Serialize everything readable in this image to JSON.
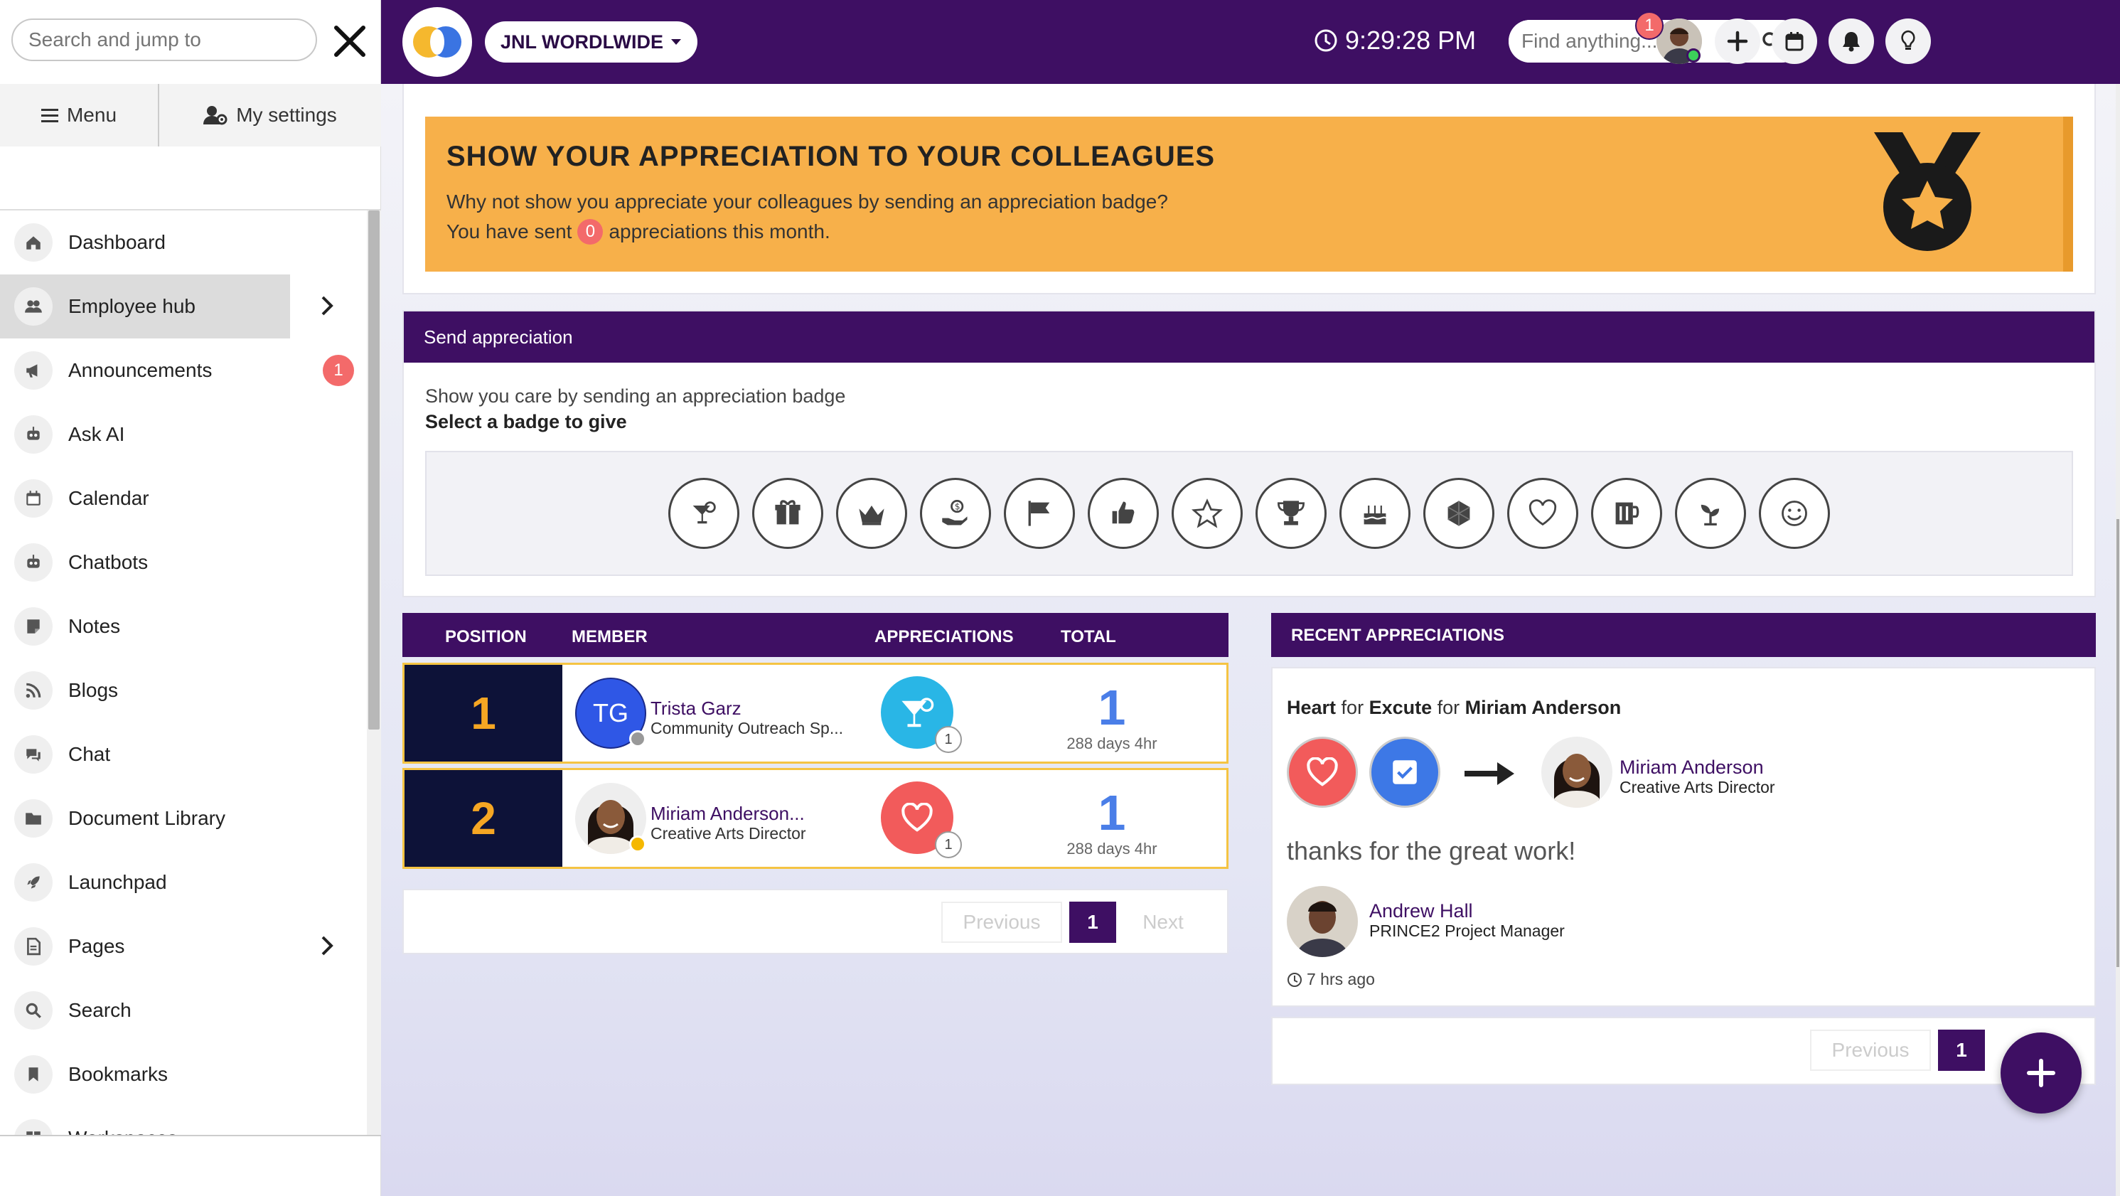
{
  "sidebar": {
    "search_placeholder": "Search and jump to",
    "tabs": {
      "menu": "Menu",
      "settings": "My settings"
    },
    "items": [
      {
        "label": "Dashboard",
        "icon": "home-icon"
      },
      {
        "label": "Employee hub",
        "icon": "users-icon",
        "active": true,
        "has_submenu": true
      },
      {
        "label": "Announcements",
        "icon": "megaphone-icon",
        "badge": "1"
      },
      {
        "label": "Ask AI",
        "icon": "robot-icon"
      },
      {
        "label": "Calendar",
        "icon": "calendar-icon"
      },
      {
        "label": "Chatbots",
        "icon": "robot-icon"
      },
      {
        "label": "Notes",
        "icon": "note-icon"
      },
      {
        "label": "Blogs",
        "icon": "rss-icon"
      },
      {
        "label": "Chat",
        "icon": "chat-icon"
      },
      {
        "label": "Document Library",
        "icon": "folder-icon"
      },
      {
        "label": "Launchpad",
        "icon": "rocket-icon"
      },
      {
        "label": "Pages",
        "icon": "page-icon",
        "has_submenu": true
      },
      {
        "label": "Search",
        "icon": "search-icon"
      },
      {
        "label": "Bookmarks",
        "icon": "bookmark-icon"
      },
      {
        "label": "Workspaces",
        "icon": "workspace-icon"
      }
    ]
  },
  "topbar": {
    "org_name": "JNL WORDLWIDE",
    "time": "9:29:28 PM",
    "find_placeholder": "Find anything...",
    "notification_count": "1"
  },
  "banner": {
    "title": "SHOW YOUR APPRECIATION TO YOUR COLLEAGUES",
    "line1": "Why not show you appreciate your colleagues by sending an appreciation badge?",
    "line2_prefix": "You have sent",
    "sent_count": "0",
    "line2_suffix": "appreciations this month."
  },
  "send": {
    "header": "Send appreciation",
    "subtitle": "Show you care by sending an appreciation badge",
    "select_label": "Select a badge to give",
    "badges": [
      "cocktail-icon",
      "gift-icon",
      "crown-icon",
      "hand-coin-icon",
      "flag-icon",
      "thumbs-up-icon",
      "star-icon",
      "trophy-icon",
      "cake-icon",
      "gem-icon",
      "heart-icon",
      "mug-icon",
      "seedling-icon",
      "smile-icon"
    ]
  },
  "leaderboard": {
    "headers": {
      "position": "POSITION",
      "member": "MEMBER",
      "appreciations": "APPRECIATIONS",
      "total": "TOTAL"
    },
    "rows": [
      {
        "position": "1",
        "initials": "TG",
        "name": "Trista Garz",
        "title": "Community Outreach Sp...",
        "badge": "cocktail-icon",
        "badge_color": "#29b6e6",
        "badge_count": "1",
        "total": "1",
        "days": "288 days 4hr",
        "status_color": "#999999"
      },
      {
        "position": "2",
        "name": "Miriam Anderson...",
        "title": "Creative Arts Director",
        "badge": "heart-icon",
        "badge_color": "#f25b5b",
        "badge_count": "1",
        "total": "1",
        "days": "288 days 4hr",
        "status_color": "#f5b800"
      }
    ],
    "pager": {
      "prev": "Previous",
      "page": "1",
      "next": "Next"
    }
  },
  "recent": {
    "header": "RECENT APPRECIATIONS",
    "badge": "Heart",
    "for1": "for",
    "value": "Excute",
    "for2": "for",
    "recipient": "Miriam Anderson",
    "recipient_name": "Miriam Anderson",
    "recipient_title": "Creative Arts Director",
    "message": "thanks for the great work!",
    "sender_name": "Andrew Hall",
    "sender_title": "PRINCE2 Project Manager",
    "time": "7 hrs ago",
    "pager": {
      "prev": "Previous",
      "page": "1"
    }
  },
  "colors": {
    "brand": "#3e0f63",
    "accent": "#f7b04a",
    "badge_red": "#f36a6a"
  }
}
